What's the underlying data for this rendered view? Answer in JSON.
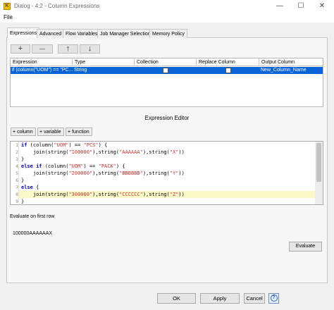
{
  "window": {
    "title": "Dialog - 4:2 - Column Expressions",
    "app_icon_glyph": "K",
    "minimize_glyph": "—",
    "maximize_glyph": "☐",
    "close_glyph": "✕"
  },
  "menu": {
    "file": "File"
  },
  "tabs": [
    {
      "label": "Expressions",
      "active": true
    },
    {
      "label": "Advanced"
    },
    {
      "label": "Flow Variables"
    },
    {
      "label": "Job Manager Selection"
    },
    {
      "label": "Memory Policy"
    }
  ],
  "toolbar": {
    "add": "+",
    "remove": "—",
    "up": "↑",
    "down": "↓"
  },
  "table": {
    "headers": [
      "Expression",
      "Type",
      "Collection",
      "Replace Column",
      "Output Column"
    ],
    "rows": [
      {
        "expression": "if (column(\"UOM\") == \"PC...",
        "type": "String",
        "collection": false,
        "replace_column": false,
        "output_column": "New_Column_Name"
      }
    ]
  },
  "editor": {
    "heading": "Expression Editor",
    "buttons": {
      "column": "column",
      "variable": "variable",
      "function": "function",
      "plus": "+"
    },
    "line_numbers": [
      "1",
      "2",
      "3",
      "4",
      "5",
      "6",
      "7",
      "8",
      "9"
    ],
    "highlighted_line": 8,
    "code": [
      "if (column(\"UOM\") == \"PCS\") {",
      "    join(string(\"100000\"),string(\"AAAAAA\"),string(\"X\"))",
      "}",
      "else if (column(\"UOM\") == \"PACK\") {",
      "    join(string(\"200000\"),string(\"BBBBBB\"),string(\"Y\"))",
      "}",
      "else {",
      "    join(string(\"300000\"),string(\"CCCCCC\"),string(\"Z\"))",
      "}"
    ]
  },
  "evaluate": {
    "label": "Evaluate on first row",
    "result": "100000AAAAAAX",
    "button": "Evaluate"
  },
  "dialog_buttons": {
    "ok": "OK",
    "apply": "Apply",
    "cancel": "Cancel",
    "help": "?"
  },
  "colors": {
    "selection": "#0a64d6",
    "keyword": "#0000cc",
    "string": "#c83232",
    "highlight_line": "#fbf8c8"
  }
}
